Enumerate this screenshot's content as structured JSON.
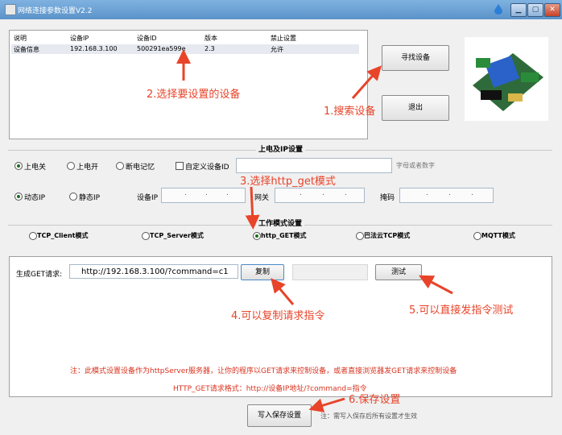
{
  "window": {
    "title": "网络连接参数设置V2.2",
    "min_label": "▁",
    "max_label": "▢",
    "close_label": "✕"
  },
  "device_list": {
    "headers": [
      "说明",
      "设备IP",
      "设备ID",
      "版本",
      "禁止设置"
    ],
    "rows": [
      [
        "设备信息",
        "192.168.3.100",
        "500291ea599e",
        "2.3",
        "允许"
      ]
    ]
  },
  "buttons": {
    "search": "寻找设备",
    "exit": "退出",
    "copy": "复制",
    "test": "测试",
    "save": "写入保存设置"
  },
  "power_ip": {
    "group_title": "上电及IP设置",
    "power_options": [
      "上电关",
      "上电开",
      "断电记忆"
    ],
    "power_selected": 0,
    "custom_id_label": "自定义设备ID",
    "custom_id_value": "",
    "custom_id_hint": "字母或者数字",
    "ip_options": [
      "动态IP",
      "静态IP"
    ],
    "ip_selected": 0,
    "device_ip_label": "设备IP",
    "gateway_label": "网关",
    "mask_label": "掩码"
  },
  "work_mode": {
    "group_title": "工作模式设置",
    "options": [
      "TCP_Client模式",
      "TCP_Server模式",
      "http_GET模式",
      "巴法云TCP模式",
      "MQTT模式"
    ],
    "selected": 2
  },
  "http_get": {
    "label": "生成GET请求:",
    "value": "http://192.168.3.100/?command=c1",
    "note": "注：此模式设置设备作为httpServer服务器，让你的程序以GET请求来控制设备，或者直接浏览器发GET请求来控制设备",
    "format": "HTTP_GET请求格式：http://设备IP地址/?command=指令"
  },
  "save_note": "注：需写入保存后所有设置才生效",
  "annotations": {
    "a1": "1.搜索设备",
    "a2": "2.选择要设置的设备",
    "a3": "3.选择http_get模式",
    "a4": "4.可以复制请求指令",
    "a5": "5.可以直接发指令测试",
    "a6": "6.保存设置"
  },
  "colors": {
    "annotation": "#e8442a",
    "titlebar": "#5b93c9"
  }
}
